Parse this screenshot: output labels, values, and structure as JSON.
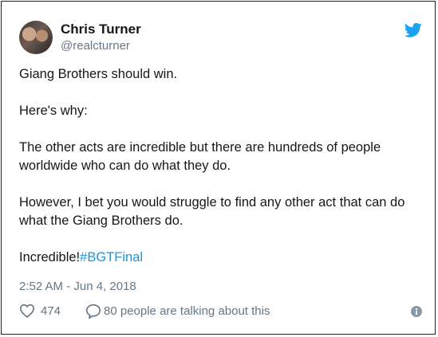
{
  "tweet": {
    "author_name": "Chris Turner",
    "author_handle": "@realcturner",
    "paragraphs": [
      "Giang Brothers should win.",
      "Here's why:",
      "The other acts are incredible but there are hundreds of people worldwide who can do what they do.",
      "However, I bet you would struggle to find any other act that can do what the Giang Brothers do."
    ],
    "closing_text": "Incredible!",
    "hashtag": "#BGTFinal",
    "timestamp": "2:52 AM - Jun 4, 2018",
    "like_count": "474",
    "reply_text": "80 people are talking about this"
  },
  "icons": {
    "bird": "twitter-bird-icon",
    "like": "heart-icon",
    "reply": "speech-bubble-icon",
    "info": "info-icon"
  },
  "colors": {
    "accent": "#1da1f2",
    "hashtag": "#1b95e0",
    "secondary_text": "#657786",
    "primary_text": "#14171a"
  }
}
